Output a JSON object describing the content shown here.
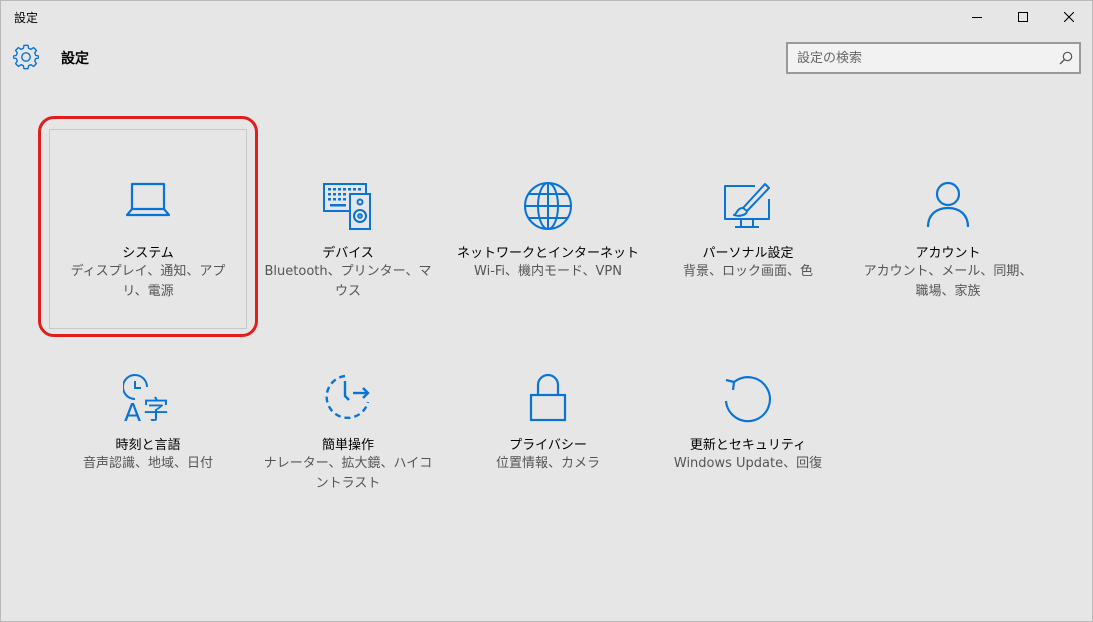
{
  "window": {
    "title": "設定"
  },
  "header": {
    "title": "設定",
    "icon": "gear-icon"
  },
  "search": {
    "placeholder": "設定の検索",
    "value": ""
  },
  "colors": {
    "accent": "#0a74d6",
    "highlight": "#e01e1e",
    "background": "#e6e6e6"
  },
  "tiles": [
    {
      "id": "system",
      "icon": "laptop-icon",
      "label": "システム",
      "desc": "ディスプレイ、通知、アプリ、電源"
    },
    {
      "id": "devices",
      "icon": "devices-icon",
      "label": "デバイス",
      "desc": "Bluetooth、プリンター、マウス"
    },
    {
      "id": "network",
      "icon": "globe-icon",
      "label": "ネットワークとインターネット",
      "desc": "Wi-Fi、機内モード、VPN"
    },
    {
      "id": "personalization",
      "icon": "personalization-icon",
      "label": "パーソナル設定",
      "desc": "背景、ロック画面、色"
    },
    {
      "id": "accounts",
      "icon": "person-icon",
      "label": "アカウント",
      "desc": "アカウント、メール、同期、職場、家族"
    },
    {
      "id": "time-language",
      "icon": "time-language-icon",
      "label": "時刻と言語",
      "desc": "音声認識、地域、日付"
    },
    {
      "id": "ease-of-access",
      "icon": "ease-of-access-icon",
      "label": "簡単操作",
      "desc": "ナレーター、拡大鏡、ハイコントラスト"
    },
    {
      "id": "privacy",
      "icon": "lock-icon",
      "label": "プライバシー",
      "desc": "位置情報、カメラ"
    },
    {
      "id": "update-security",
      "icon": "refresh-icon",
      "label": "更新とセキュリティ",
      "desc": "Windows Update、回復"
    }
  ]
}
